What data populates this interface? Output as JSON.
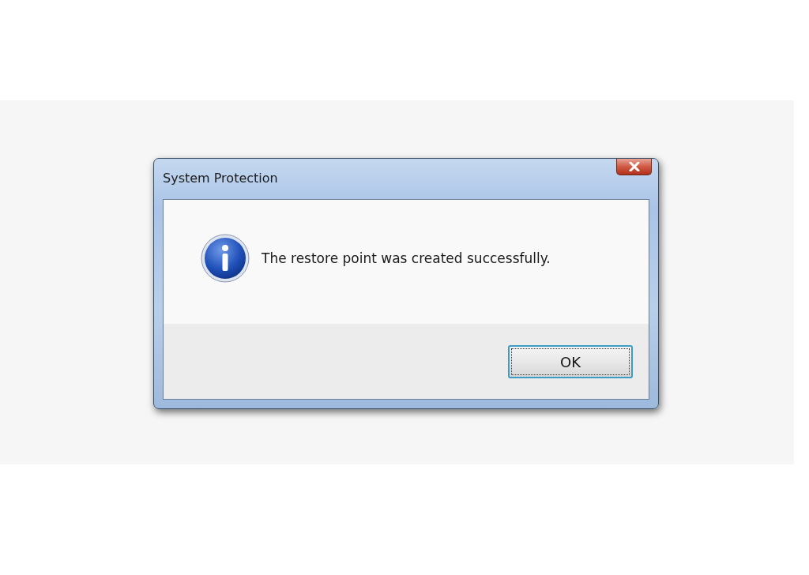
{
  "window": {
    "title": "System Protection"
  },
  "message": {
    "kind": "information",
    "text": "The restore point was created successfully."
  },
  "buttons": [
    {
      "label": "OK",
      "focused": true
    }
  ]
}
